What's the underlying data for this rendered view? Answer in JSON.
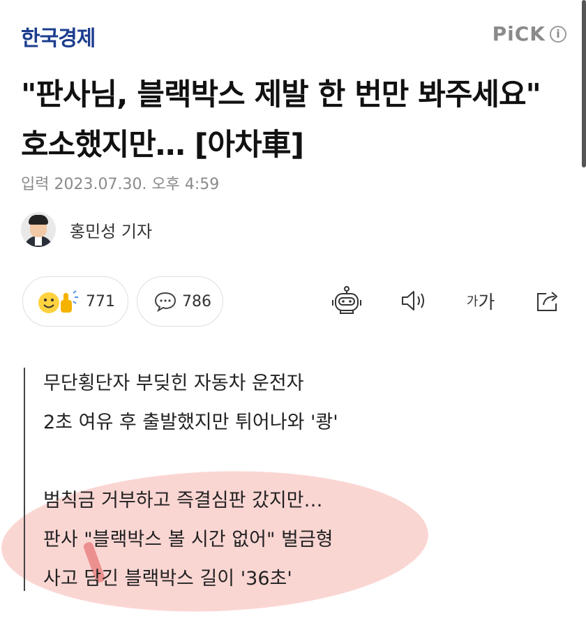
{
  "header": {
    "press_name": "한국경제",
    "pick_label": "PiCK",
    "info_glyph": "i"
  },
  "article": {
    "title": "\"판사님, 블랙박스 제발 한 번만 봐주세요\" 호소했지만… [아차車]",
    "datetime": "입력 2023.07.30. 오후 4:59",
    "reporter": "홍민성 기자"
  },
  "actions": {
    "reaction_count": "771",
    "comment_count": "786",
    "font_size_label_small": "가",
    "font_size_label_large": "가"
  },
  "icons": {
    "reaction": "smile-thumbs-up-icon",
    "comment": "speech-bubble-icon",
    "summary_bot": "robot-icon",
    "tts": "speaker-icon",
    "font_size": "font-size-icon",
    "share": "share-icon"
  },
  "summary": {
    "lines": [
      "무단횡단자 부딪힌 자동차 운전자",
      "2초 여유 후 출발했지만 튀어나와 '쾅'",
      "범칙금 거부하고 즉결심판 갔지만…",
      "판사 \"블랙박스 볼 시간 없어\" 벌금형",
      "사고 담긴 블랙박스 길이 '36초'"
    ]
  },
  "colors": {
    "press": "#1c3d8f",
    "highlight": "#f0786e",
    "muted": "#8a8a8a"
  }
}
